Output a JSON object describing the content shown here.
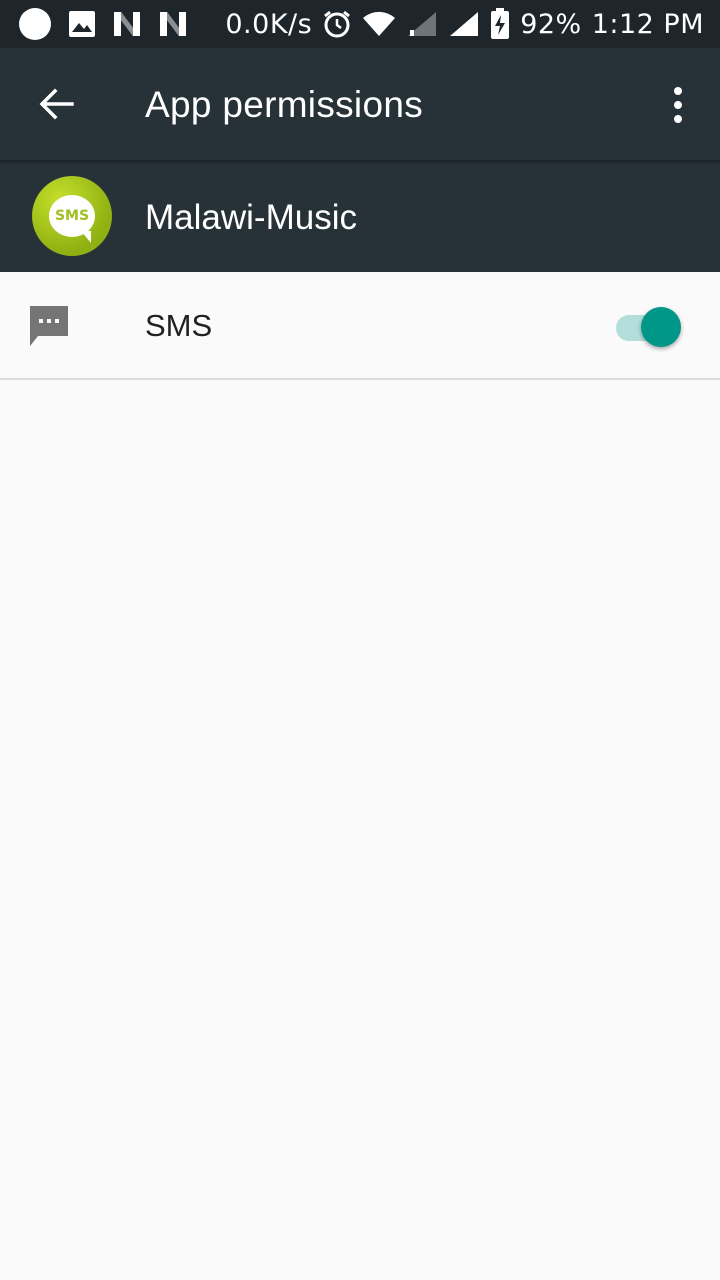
{
  "status_bar": {
    "network_speed": "0.0K/s",
    "battery_percent": "92%",
    "time": "1:12 PM",
    "icons": [
      "circle-notification-icon",
      "image-icon",
      "n-notification-icon",
      "n-notification-icon",
      "alarm-icon",
      "wifi-icon",
      "signal-icon",
      "signal-icon",
      "battery-charging-icon"
    ]
  },
  "toolbar": {
    "title": "App permissions",
    "back_icon": "arrow-back-icon",
    "more_icon": "more-vert-icon"
  },
  "app": {
    "name": "Malawi-Music",
    "icon_text": "SMS",
    "icon_color": "#a4c41a"
  },
  "permissions": [
    {
      "label": "SMS",
      "icon": "sms-icon",
      "enabled": true
    }
  ],
  "colors": {
    "toolbar": "#263238",
    "status_bar": "#1e262b",
    "accent": "#009688",
    "background": "#fafafa"
  }
}
